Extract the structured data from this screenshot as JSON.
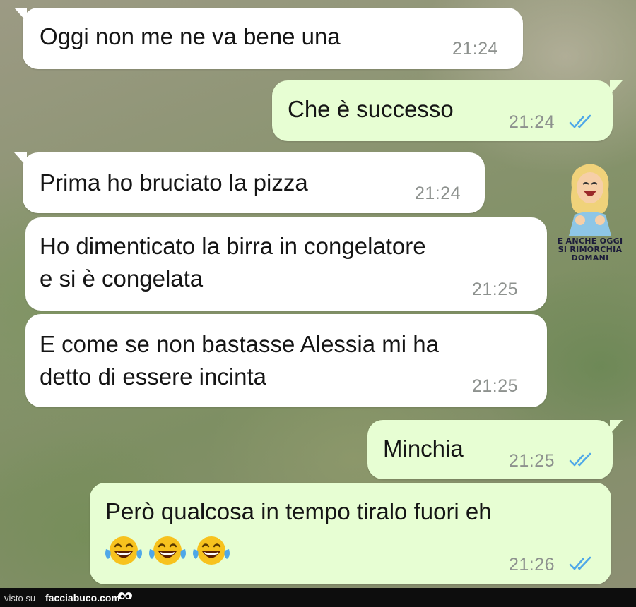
{
  "messages": [
    {
      "text": "Oggi non me ne va bene una",
      "time": "21:24",
      "direction": "incoming"
    },
    {
      "text": "Che è successo",
      "time": "21:24",
      "direction": "outgoing",
      "read": true
    },
    {
      "text": "Prima ho bruciato la pizza",
      "time": "21:24",
      "direction": "incoming"
    },
    {
      "text": "Ho dimenticato la birra in congelatore\ne si è congelata",
      "time": "21:25",
      "direction": "incoming"
    },
    {
      "text": "E come se non bastasse Alessia mi ha\ndetto di essere incinta",
      "time": "21:25",
      "direction": "incoming"
    },
    {
      "text": "Minchia",
      "time": "21:25",
      "direction": "outgoing",
      "read": true
    },
    {
      "text": "Però qualcosa in tempo tiralo fuori eh",
      "emoji": "😂😂😂",
      "time": "21:26",
      "direction": "outgoing",
      "read": true
    }
  ],
  "sticker": {
    "caption_line1": "E ANCHE OGGI",
    "caption_line2": "SI RIMORCHIA DOMANI"
  },
  "footer": {
    "prefix": "visto su",
    "site": "facciabuco.com"
  },
  "colors": {
    "incoming": "#ffffff",
    "outgoing": "#e7fed3",
    "read_ticks": "#4fa8e8",
    "time": "#8d918e"
  }
}
